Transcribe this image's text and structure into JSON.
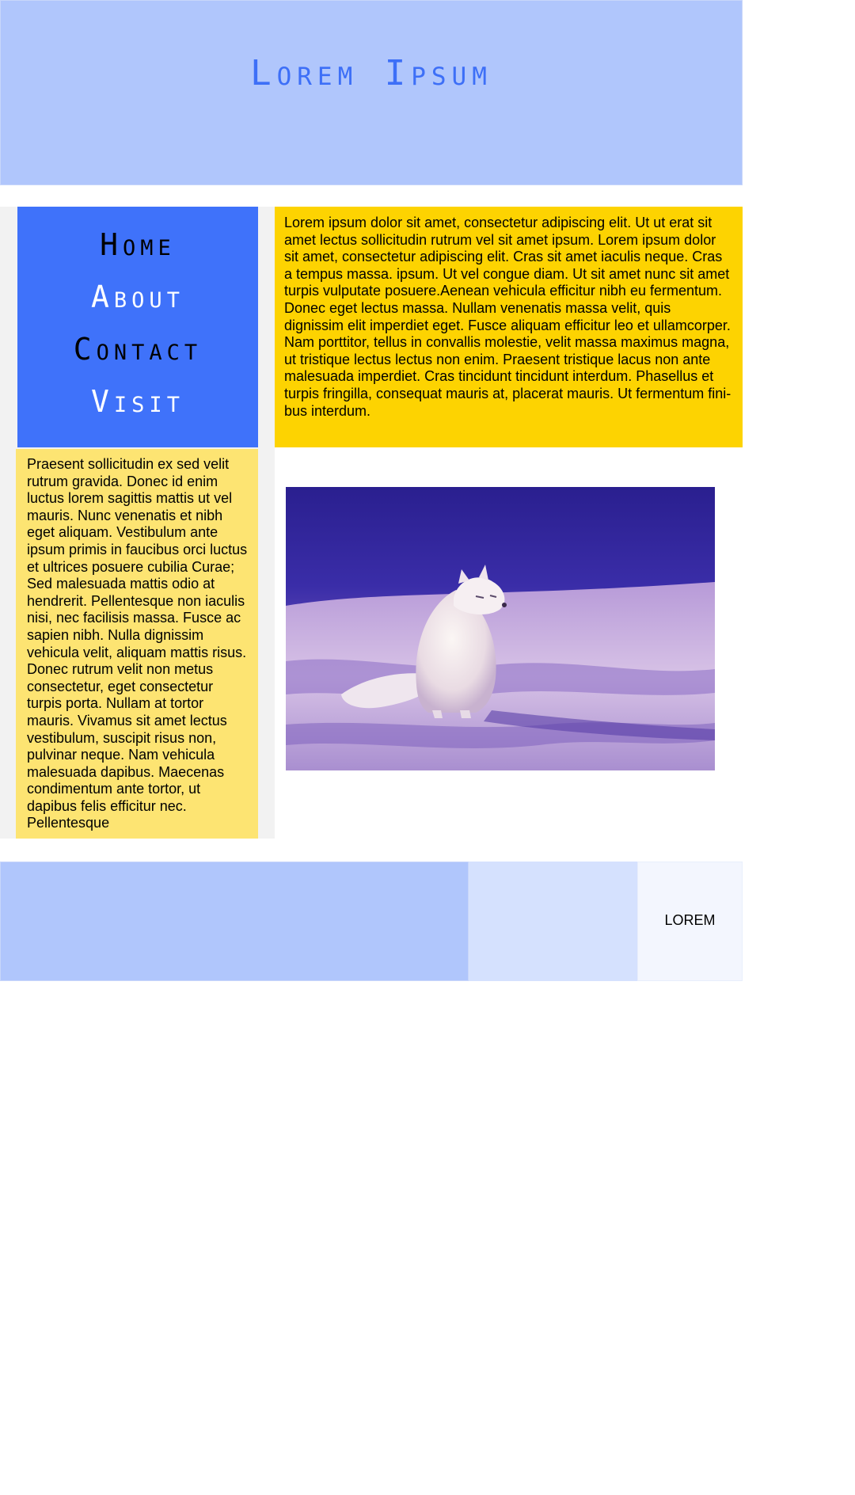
{
  "header": {
    "title": "Lorem Ipsum"
  },
  "nav": {
    "items": [
      {
        "label": "Home"
      },
      {
        "label": "About"
      },
      {
        "label": "Contact"
      },
      {
        "label": "Visit"
      }
    ]
  },
  "main": {
    "paragraph": "Lorem ipsum dolor sit amet, consectetur adipiscing elit. Ut ut erat sit amet lectus sollicitudin rutrum vel sit amet ipsum. Lorem ipsum dolor sit amet, consectetur adipiscing elit. Cras sit amet iaculis neque. Cras a tempus massa. ipsum. Ut vel congue diam. Ut sit amet nunc sit amet turpis vulputate posuere.Aenean vehicula efficitur nibh eu fermentum. Donec eget lectus massa. Nullam venenatis massa velit, quis dignissim elit imperdiet eget. Fusce aliquam efficitur leo et ullamcorper. Nam porttitor, tellus in con­vallis molestie, velit massa maximus magna, ut tristique lectus lectus non enim. Praesent tristique lacus non ante malesuada imperdiet. Cras tincidunt tincidunt interdum. Phasellus et turpis fringilla, consequat mauris at, placerat mauris. Ut fermentum fini­bus interdum."
  },
  "sidebar": {
    "paragraph": "Praesent sollicitudin ex sed velit rutrum gravida. Donec id enim luctus lorem sagittis mattis ut vel mauris. Nunc venenatis et nibh eget aliquam. Vestibulum ante ipsum primis in faucibus orci luctus et ultrices posuere cubilia Curae; Sed malesuada mattis odio at hendrerit. Pellentesque non iaculis nisi, nec facilisis massa. Fusce ac sapien nibh. Nulla dignissim vehicula velit, aliquam mattis risus. Donec rutrum velit non metus consec­tetur, eget consectetur turpis porta. Nullam at tortor mauris. Vivamus sit amet lectus vestibu­lum, suscipit risus non, pulvinar neque. Nam vehicula malesua­da dapibus. Maecenas condi­mentum ante tortor, ut dapibus felis efficitur nec. Pellentesque"
  },
  "footer": {
    "label": "LOREM"
  },
  "colors": {
    "header_bg": "#b0c6fc",
    "title_color": "#3d6ff7",
    "nav_bg": "#3f72fa",
    "main_text_bg": "#fdd301",
    "side_text_bg": "#fde472",
    "footer_a": "#b0c6fc",
    "footer_b": "#d5e1fe",
    "footer_c": "#f3f6fe"
  }
}
